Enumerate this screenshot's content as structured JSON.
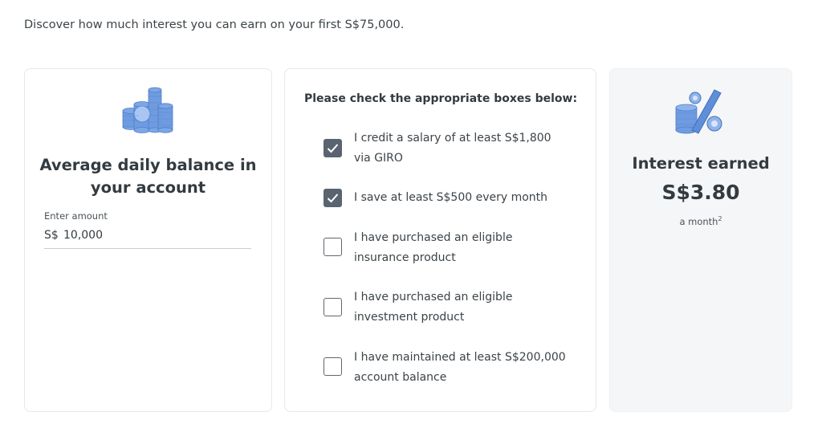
{
  "intro_text": "Discover how much interest you can earn on your first S$75,000.",
  "balance_card": {
    "icon": "coin-stack-icon",
    "title": "Average daily balance in your account",
    "field_label": "Enter amount",
    "currency_prefix": "S$",
    "amount_value": "10,000"
  },
  "checks_card": {
    "heading": "Please check the appropriate boxes below:",
    "items": [
      {
        "label": "I credit a salary of at least S$1,800 via GIRO",
        "checked": true
      },
      {
        "label": "I save at least S$500 every month",
        "checked": true
      },
      {
        "label": "I have purchased an eligible insurance product",
        "checked": false
      },
      {
        "label": "I have purchased an eligible investment product",
        "checked": false
      },
      {
        "label": "I have maintained at least S$200,000 account balance",
        "checked": false
      }
    ]
  },
  "result_card": {
    "icon": "percent-coins-icon",
    "title": "Interest earned",
    "value": "S$3.80",
    "period": "a month",
    "footnote": "2"
  },
  "colors": {
    "checkbox_checked": "#5a6470",
    "icon_blue": "#6f9be0",
    "result_bg": "#f5f6f8"
  }
}
